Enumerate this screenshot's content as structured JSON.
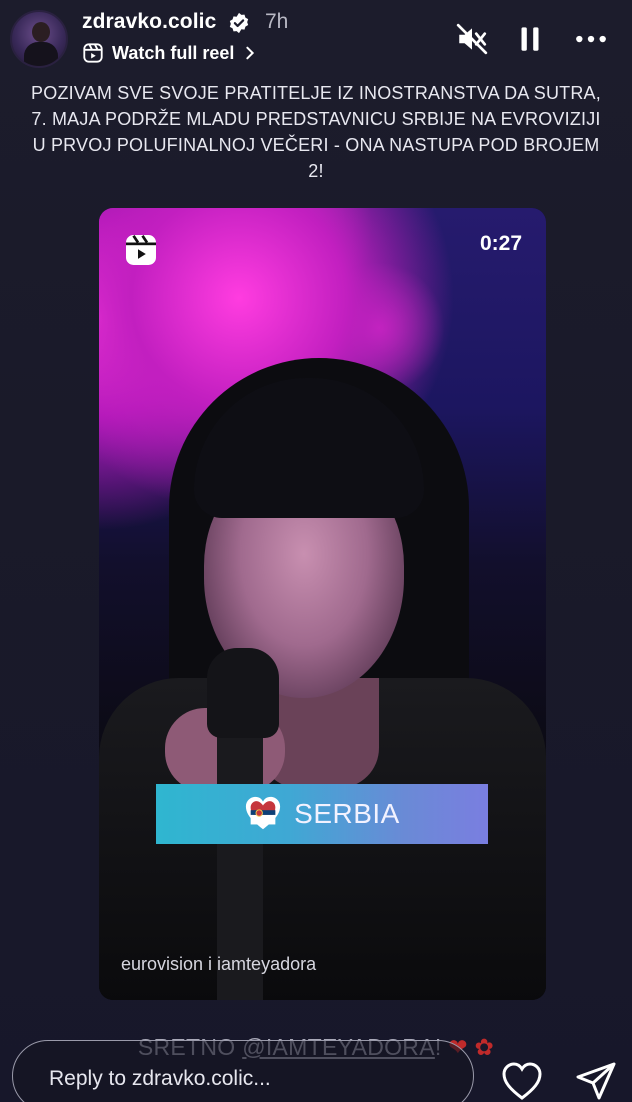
{
  "header": {
    "username": "zdravko.colic",
    "time": "7h",
    "watch_label": "Watch full reel",
    "verified": true,
    "icons": [
      "mute-icon",
      "pause-icon",
      "more-icon"
    ]
  },
  "caption": "POZIVAM SVE SVOJE PRATITELJE IZ INOSTRANSTVA DA SUTRA, 7. MAJA PODRŽE MLADU PREDSTAVNICU SRBIJE NA EVROVIZIJI U PRVOJ POLUFINALNOJ VEČERI - ONA NASTUPA POD BROJEM 2!",
  "video": {
    "duration": "0:27",
    "banner_country": "SERBIA",
    "credit": "eurovision i iamteyadora"
  },
  "mention": {
    "prefix": "SRETNO ",
    "handle": "@IAMTEYADORA",
    "suffix": "!"
  },
  "reply": {
    "placeholder": "Reply to zdravko.colic..."
  },
  "colors": {
    "background": "#1c1c2c",
    "verified_badge": "#ffffff",
    "banner_start": "#2fb6d0",
    "banner_end": "#7a7ee0"
  }
}
